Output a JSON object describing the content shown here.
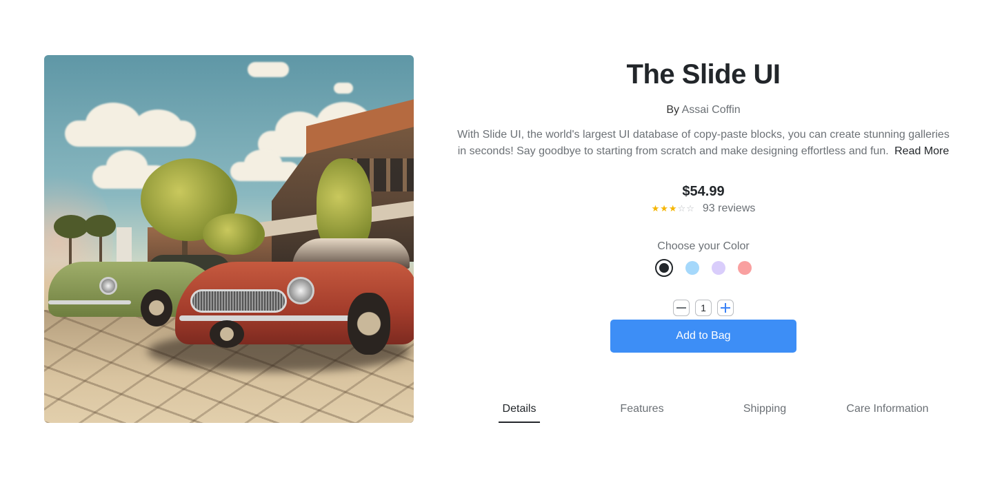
{
  "product": {
    "title": "The Slide UI",
    "byline_prefix": "By",
    "author": "Assai Coffin",
    "description": "With Slide UI, the world's largest UI database of copy-paste blocks, you can create stunning galleries in seconds! Say goodbye to starting from scratch and make designing effortless and fun.",
    "read_more": "Read More",
    "price": "$54.99",
    "rating": {
      "stars": 3,
      "max": 5,
      "reviews_label": "93 reviews"
    },
    "image": {
      "icon": "vintage-cars-photo"
    }
  },
  "color_picker": {
    "label": "Choose your Color",
    "selected_index": 0,
    "options": [
      {
        "name": "dark",
        "hex": "#22262a"
      },
      {
        "name": "sky",
        "hex": "#a5d8fb"
      },
      {
        "name": "lavender",
        "hex": "#d9cdfb"
      },
      {
        "name": "salmon",
        "hex": "#f9a0a0"
      }
    ]
  },
  "quantity": {
    "value": "1",
    "decrement_icon": "minus-icon",
    "increment_icon": "plus-icon"
  },
  "cta": {
    "label": "Add to Bag",
    "color": "#3d8ef6"
  },
  "tabs": [
    {
      "label": "Details",
      "active": true
    },
    {
      "label": "Features",
      "active": false
    },
    {
      "label": "Shipping",
      "active": false
    },
    {
      "label": "Care Information",
      "active": false
    }
  ]
}
